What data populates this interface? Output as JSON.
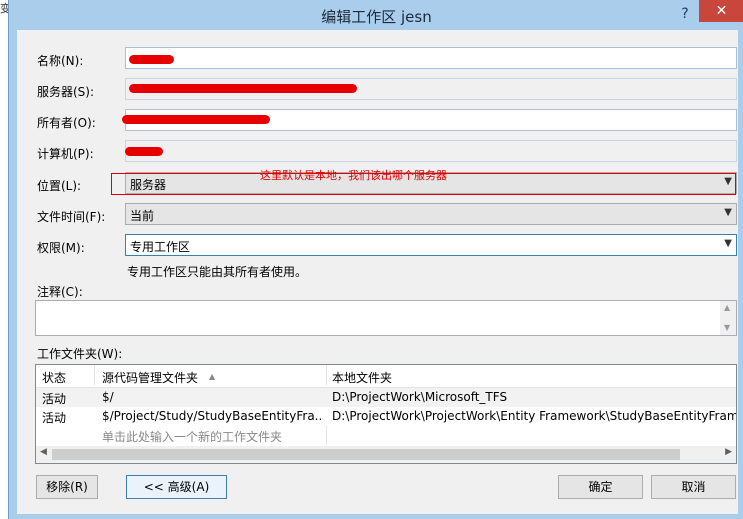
{
  "dialog": {
    "title": "编辑工作区 jesn",
    "help_label": "?",
    "close_label": "✕",
    "bg_mark": "变"
  },
  "fields": {
    "name": {
      "label": "名称(N):",
      "value": ""
    },
    "server": {
      "label": "服务器(S):",
      "value": ""
    },
    "owner": {
      "label": "所有者(O):",
      "value": ""
    },
    "computer": {
      "label": "计算机(P):",
      "value": ""
    },
    "location": {
      "label": "位置(L):",
      "value": "服务器"
    },
    "file_time": {
      "label": "文件时间(F):",
      "value": "当前"
    },
    "permission": {
      "label": "权限(M):",
      "value": "专用工作区"
    },
    "permission_help": "专用工作区只能由其所有者使用。",
    "comment_label": "注释(C):"
  },
  "annotation": "这里默认是本地，我们该出哪个服务器",
  "folders": {
    "label": "工作文件夹(W):",
    "columns": [
      "状态",
      "源代码管理文件夹",
      "本地文件夹"
    ],
    "sort_icon": "▲",
    "rows": [
      {
        "status": "活动",
        "source": "$/",
        "local": "D:\\ProjectWork\\Microsoft_TFS"
      },
      {
        "status": "活动",
        "source": "$/Project/Study/StudyBaseEntityFra...",
        "local": "D:\\ProjectWork\\ProjectWork\\Entity Framework\\StudyBaseEntityFrame"
      }
    ],
    "new_row_hint": "单击此处输入一个新的工作文件夹"
  },
  "buttons": {
    "remove": "移除(R)",
    "advanced": "<< 高级(A)",
    "ok": "确定",
    "cancel": "取消"
  },
  "colors": {
    "accent": "#3c7fb1",
    "annotation": "#e00000",
    "titlebar": "#aacdec",
    "close": "#c9463d"
  }
}
